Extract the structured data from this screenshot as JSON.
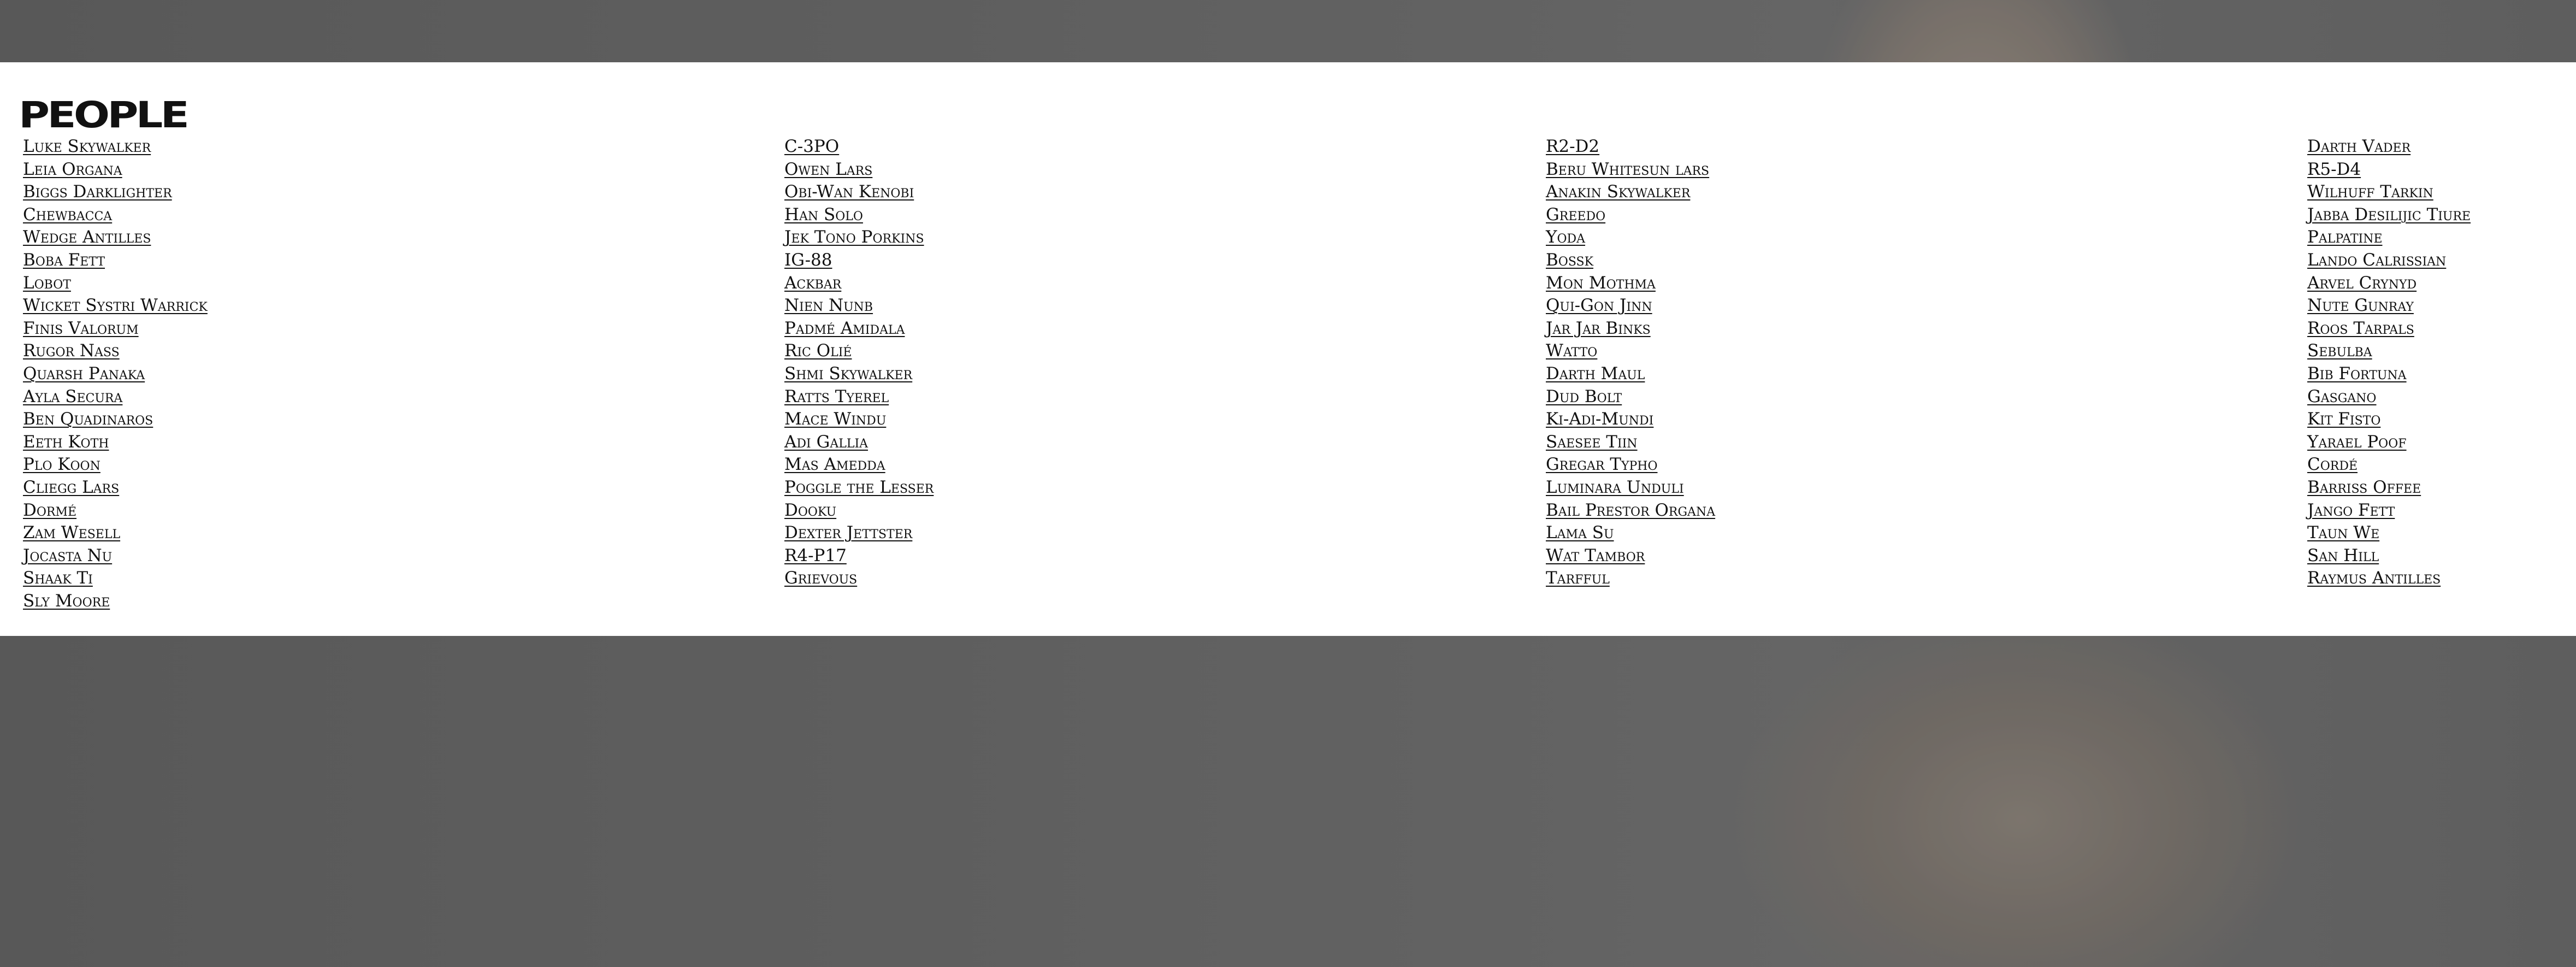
{
  "section": {
    "title": "PEOPLE"
  },
  "columns": [
    [
      "Luke Skywalker",
      "Leia Organa",
      "Biggs Darklighter",
      "Chewbacca",
      "Wedge Antilles",
      "Boba Fett",
      "Lobot",
      "Wicket Systri Warrick",
      "Finis Valorum",
      "Rugor Nass",
      "Quarsh Panaka",
      "Ayla Secura",
      "Ben Quadinaros",
      "Eeth Koth",
      "Plo Koon",
      "Cliegg Lars",
      "Dormé",
      "Zam Wesell",
      "Jocasta Nu",
      "Shaak Ti",
      "Sly Moore"
    ],
    [
      "C-3PO",
      "Owen Lars",
      "Obi-Wan Kenobi",
      "Han Solo",
      "Jek Tono Porkins",
      "IG-88",
      "Ackbar",
      "Nien Nunb",
      "Padmé Amidala",
      "Ric Olié",
      "Shmi Skywalker",
      "Ratts Tyerel",
      "Mace Windu",
      "Adi Gallia",
      "Mas Amedda",
      "Poggle the Lesser",
      "Dooku",
      "Dexter Jettster",
      "R4-P17",
      "Grievous"
    ],
    [
      "R2-D2",
      "Beru Whitesun lars",
      "Anakin Skywalker",
      "Greedo",
      "Yoda",
      "Bossk",
      "Mon Mothma",
      "Qui-Gon Jinn",
      "Jar Jar Binks",
      "Watto",
      "Darth Maul",
      "Dud Bolt",
      "Ki-Adi-Mundi",
      "Saesee Tiin",
      "Gregar Typho",
      "Luminara Unduli",
      "Bail Prestor Organa",
      "Lama Su",
      "Wat Tambor",
      "Tarfful"
    ],
    [
      "Darth Vader",
      "R5-D4",
      "Wilhuff Tarkin",
      "Jabba Desilijic Tiure",
      "Palpatine",
      "Lando Calrissian",
      "Arvel Crynyd",
      "Nute Gunray",
      "Roos Tarpals",
      "Sebulba",
      "Bib Fortuna",
      "Gasgano",
      "Kit Fisto",
      "Yarael Poof",
      "Cordé",
      "Barriss Offee",
      "Jango Fett",
      "Taun We",
      "San Hill",
      "Raymus Antilles"
    ]
  ]
}
